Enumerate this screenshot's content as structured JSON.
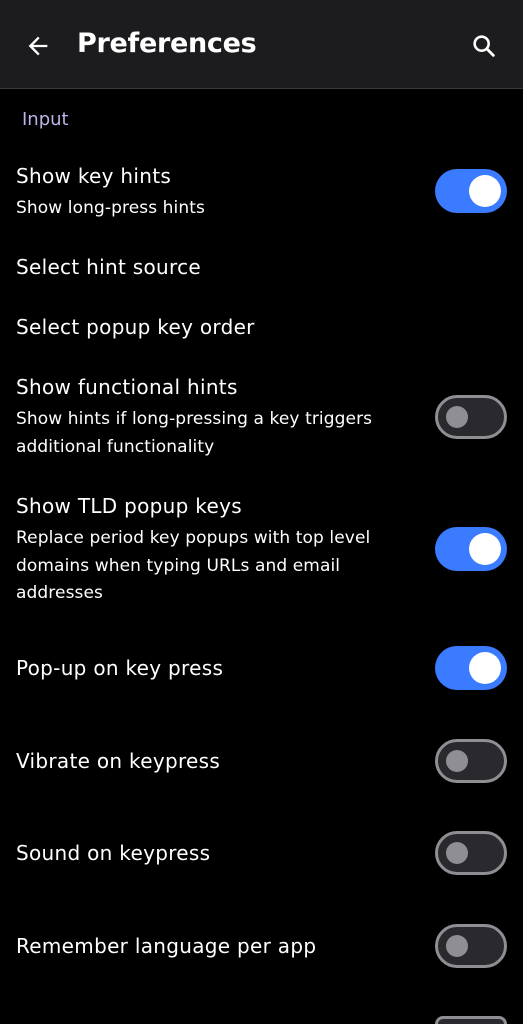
{
  "appbar": {
    "title": "Preferences",
    "back_icon": "arrow-back-icon",
    "search_icon": "search-icon"
  },
  "colors": {
    "background": "#000000",
    "appbar": "#1c1c1e",
    "accent": "#3b7bff",
    "section_header": "#b9b5e8"
  },
  "section": {
    "label": "Input"
  },
  "settings": [
    {
      "title": "Show key hints",
      "summary": "Show long-press hints",
      "switch": true
    },
    {
      "title": "Select hint source",
      "summary": "",
      "switch": null
    },
    {
      "title": "Select popup key order",
      "summary": "",
      "switch": null
    },
    {
      "title": "Show functional hints",
      "summary_lines": [
        "Show hints if long-pressing a key triggers",
        "additional functionality"
      ],
      "switch": false
    },
    {
      "title": "Show TLD popup keys",
      "summary_lines": [
        "Replace period key popups with top level",
        "domains when typing URLs and email",
        "addresses"
      ],
      "switch": true
    },
    {
      "title": "Pop-up on key press",
      "summary": "",
      "switch": true
    },
    {
      "title": "Vibrate on keypress",
      "summary": "",
      "switch": false
    },
    {
      "title": "Sound on keypress",
      "summary": "",
      "switch": false
    },
    {
      "title": "Remember language per app",
      "summary": "",
      "switch": false
    }
  ]
}
